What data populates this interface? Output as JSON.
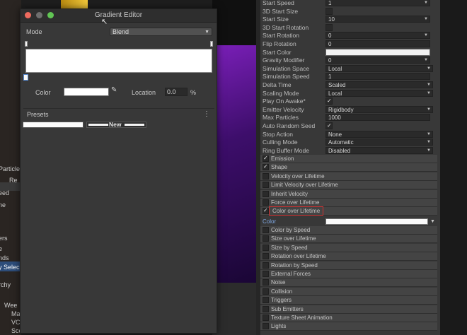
{
  "gradient_editor": {
    "title": "Gradient Editor",
    "mode_label": "Mode",
    "mode_value": "Blend",
    "color_label": "Color",
    "location_label": "Location",
    "location_value": "0.0",
    "location_unit": "%",
    "presets_label": "Presets",
    "new_preset_label": "New",
    "colors": {
      "gradient_start": "#ffffff",
      "gradient_end": "#ffffff",
      "selected_color": "#ffffff"
    }
  },
  "background_left": {
    "labels": [
      "Particle",
      "Re",
      "eed",
      "ne",
      "ers",
      "e",
      "nds",
      "y Selec",
      "rchy",
      "Wee",
      "Ma",
      "VCa",
      "Scene"
    ]
  },
  "inspector": {
    "properties": [
      {
        "label": "Start Speed",
        "type": "value",
        "value": "1"
      },
      {
        "label": "3D Start Size",
        "type": "check",
        "checked": false
      },
      {
        "label": "Start Size",
        "type": "value",
        "value": "10"
      },
      {
        "label": "3D Start Rotation",
        "type": "check",
        "checked": false
      },
      {
        "label": "Start Rotation",
        "type": "value",
        "value": "0"
      },
      {
        "label": "Flip Rotation",
        "type": "value",
        "value": "0"
      },
      {
        "label": "Start Color",
        "type": "color",
        "value": ""
      },
      {
        "label": "Gravity Modifier",
        "type": "value",
        "value": "0"
      },
      {
        "label": "Simulation Space",
        "type": "dropdown",
        "value": "Local"
      },
      {
        "label": "Simulation Speed",
        "type": "value",
        "value": "1"
      },
      {
        "label": "Delta Time",
        "type": "dropdown",
        "value": "Scaled"
      },
      {
        "label": "Scaling Mode",
        "type": "dropdown",
        "value": "Local"
      },
      {
        "label": "Play On Awake*",
        "type": "check",
        "checked": true
      },
      {
        "label": "Emitter Velocity",
        "type": "dropdown",
        "value": "Rigidbody"
      },
      {
        "label": "Max Particles",
        "type": "value",
        "value": "1000"
      },
      {
        "label": "Auto Random Seed",
        "type": "check",
        "checked": true
      },
      {
        "label": "Stop Action",
        "type": "dropdown",
        "value": "None"
      },
      {
        "label": "Culling Mode",
        "type": "dropdown",
        "value": "Automatic"
      },
      {
        "label": "Ring Buffer Mode",
        "type": "dropdown",
        "value": "Disabled"
      }
    ],
    "modules_top": [
      {
        "label": "Emission",
        "checked": true
      },
      {
        "label": "Shape",
        "checked": true
      },
      {
        "label": "Velocity over Lifetime",
        "checked": false
      },
      {
        "label": "Limit Velocity over Lifetime",
        "checked": false
      },
      {
        "label": "Inherit Velocity",
        "checked": false
      },
      {
        "label": "Force over Lifetime",
        "checked": false
      },
      {
        "label": "Color over Lifetime",
        "checked": true,
        "highlighted": true
      }
    ],
    "color_sub_label": "Color",
    "modules_bottom": [
      {
        "label": "Color by Speed",
        "checked": false
      },
      {
        "label": "Size over Lifetime",
        "checked": false
      },
      {
        "label": "Size by Speed",
        "checked": false
      },
      {
        "label": "Rotation over Lifetime",
        "checked": false
      },
      {
        "label": "Rotation by Speed",
        "checked": false
      },
      {
        "label": "External Forces",
        "checked": false
      },
      {
        "label": "Noise",
        "checked": false
      },
      {
        "label": "Collision",
        "checked": false
      },
      {
        "label": "Triggers",
        "checked": false
      },
      {
        "label": "Sub Emitters",
        "checked": false
      },
      {
        "label": "Texture Sheet Animation",
        "checked": false
      },
      {
        "label": "Lights",
        "checked": false
      }
    ]
  },
  "icons": {
    "eyedropper": "eyedropper-icon",
    "menu": "kebab-menu-icon",
    "dropdown": "chevron-down-icon",
    "check": "checkmark-icon"
  }
}
